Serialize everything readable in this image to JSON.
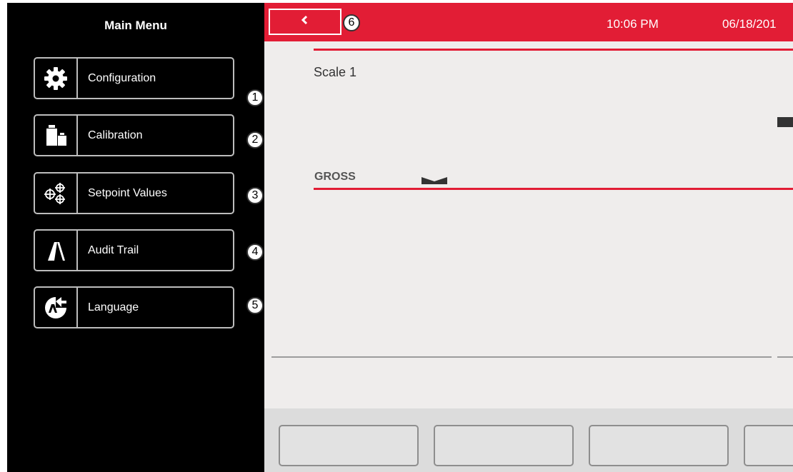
{
  "sidebar": {
    "title": "Main Menu",
    "items": [
      {
        "label": "Configuration",
        "callout": "1",
        "icon": "gear-icon"
      },
      {
        "label": "Calibration",
        "callout": "2",
        "icon": "weights-icon"
      },
      {
        "label": "Setpoint Values",
        "callout": "3",
        "icon": "setpoints-icon"
      },
      {
        "label": "Audit Trail",
        "callout": "4",
        "icon": "audit-trail-icon"
      },
      {
        "label": "Language",
        "callout": "5",
        "icon": "language-icon"
      }
    ]
  },
  "header": {
    "back_callout": "6",
    "time": "10:06 PM",
    "date": "06/18/201",
    "color": "#e21d35"
  },
  "scale": {
    "name": "Scale 1",
    "mode": "GROSS"
  },
  "colors": {
    "accent": "#e21d35",
    "sidebar_bg": "#000000",
    "main_bg": "#efedec"
  }
}
